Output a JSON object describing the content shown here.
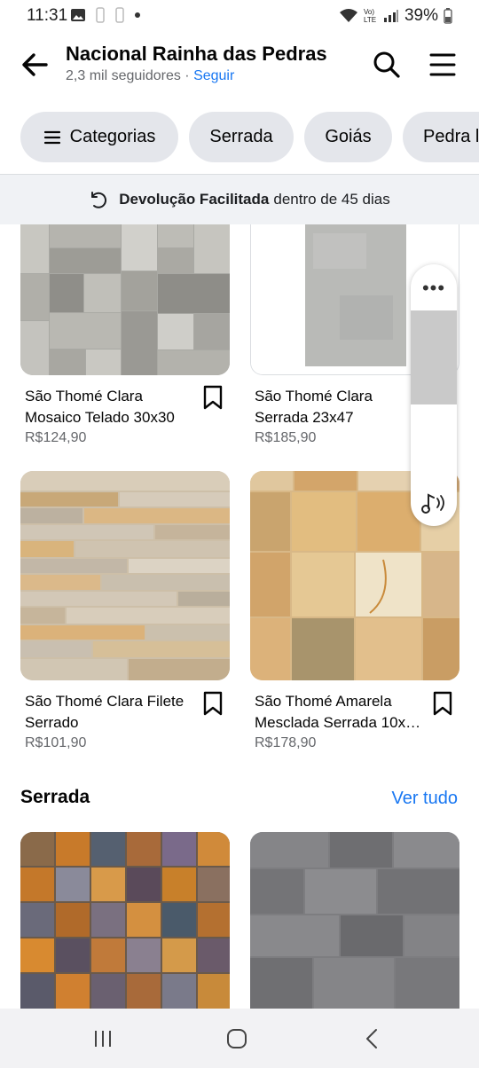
{
  "status": {
    "time": "11:31",
    "battery": "39%",
    "network": "Vo) LTE"
  },
  "header": {
    "title": "Nacional Rainha das Pedras",
    "followers": "2,3 mil seguidores",
    "separator": " · ",
    "follow": "Seguir"
  },
  "chips": [
    "Categorias",
    "Serrada",
    "Goiás",
    "Pedra l"
  ],
  "banner": {
    "bold": "Devolução Facilitada",
    "rest": "dentro de 45 dias"
  },
  "products": [
    {
      "title": "São Thomé Clara Mosaico Telado 30x30",
      "price": "R$124,90"
    },
    {
      "title": "São Thomé Clara Serrada 23x47",
      "price": "R$185,90"
    },
    {
      "title": "São Thomé Clara Filete Serrado",
      "price": "R$101,90"
    },
    {
      "title": "São Thomé Amarela Mesclada Serrada 10x…",
      "price": "R$178,90"
    }
  ],
  "section": {
    "title": "Serrada",
    "see_all": "Ver tudo"
  },
  "icons": {
    "back": "arrow-left-icon",
    "search": "search-icon",
    "menu": "hamburger-menu-icon",
    "chip_menu": "list-icon",
    "return": "return-arrow-icon",
    "bookmark": "bookmark-icon",
    "more": "more-dots-icon",
    "audio": "audio-note-icon"
  },
  "colors": {
    "accent": "#1877f2",
    "chip_bg": "#e4e6eb",
    "banner_bg": "#f0f2f5"
  }
}
